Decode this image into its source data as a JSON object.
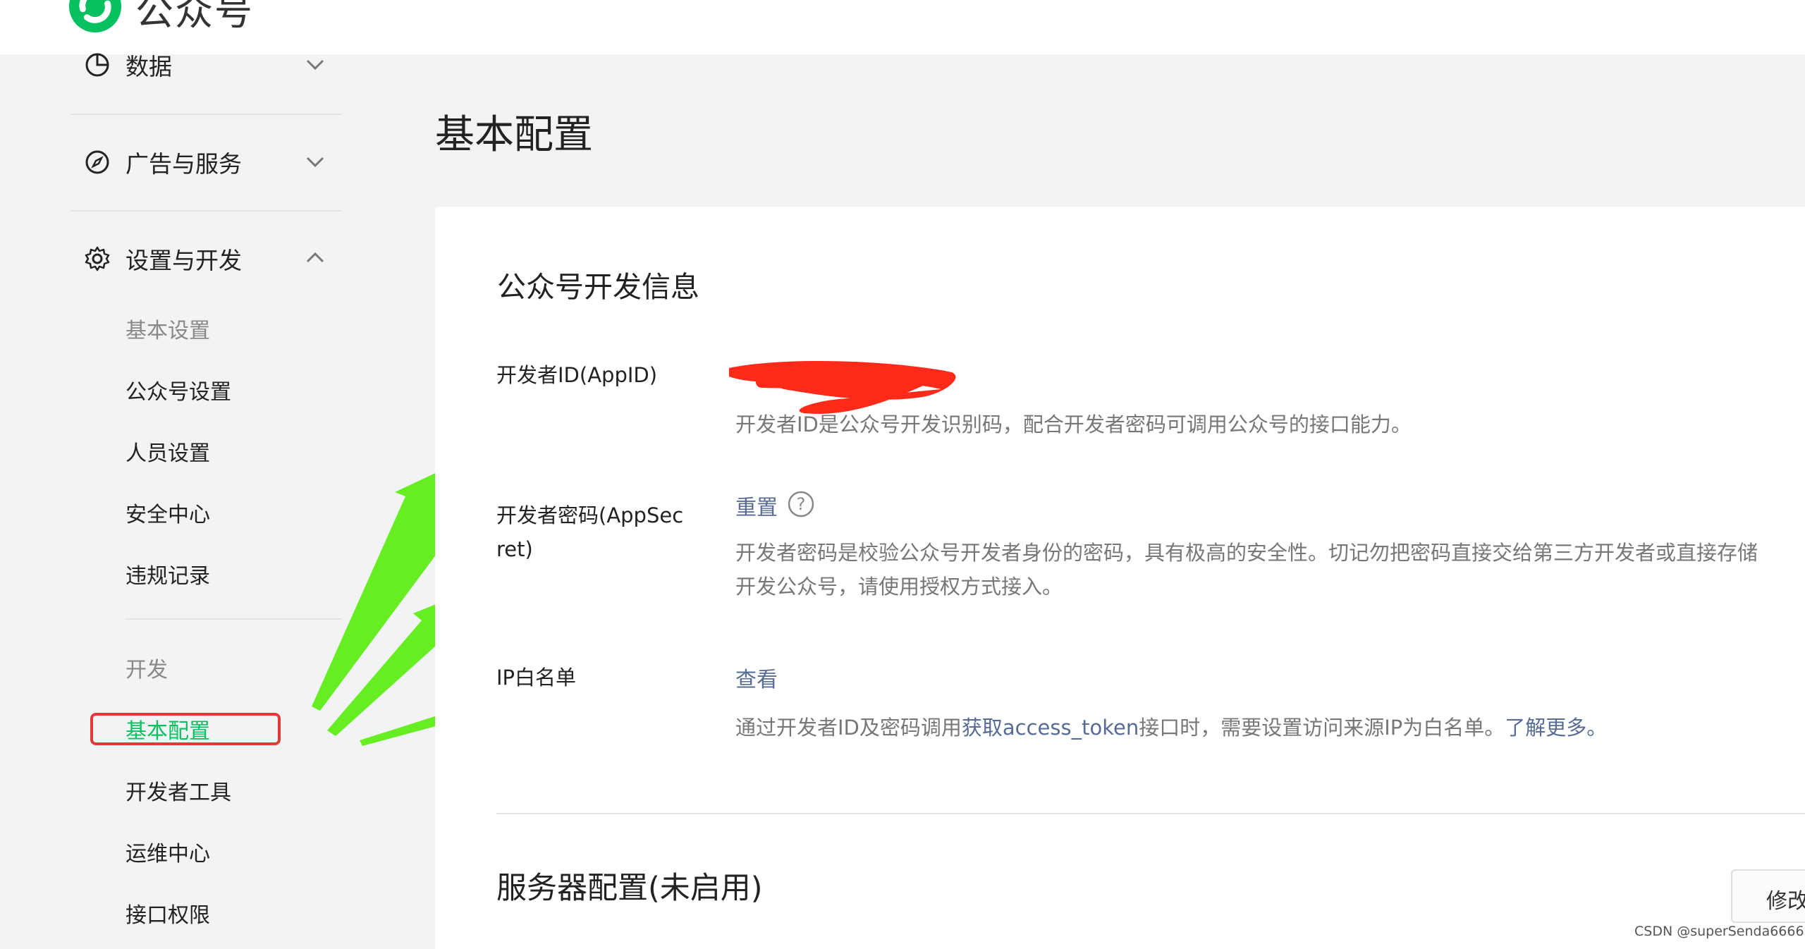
{
  "header": {
    "brand": "公众号"
  },
  "sidebar": {
    "sections": [
      {
        "label": "数据",
        "icon": "pie-chart-icon",
        "expanded": false
      },
      {
        "label": "广告与服务",
        "icon": "compass-icon",
        "expanded": false
      },
      {
        "label": "设置与开发",
        "icon": "gear-icon",
        "expanded": true
      }
    ],
    "settings_group_label": "基本设置",
    "settings_items": [
      "公众号设置",
      "人员设置",
      "安全中心",
      "违规记录"
    ],
    "dev_group_label": "开发",
    "dev_items": [
      "基本配置",
      "开发者工具",
      "运维中心",
      "接口权限"
    ],
    "active_item": "基本配置"
  },
  "main": {
    "page_title": "基本配置",
    "card_title": "公众号开发信息",
    "appid": {
      "label": "开发者ID(AppID)",
      "desc": "开发者ID是公众号开发识别码，配合开发者密码可调用公众号的接口能力。"
    },
    "secret": {
      "label": "开发者密码(AppSecret)",
      "label_line1": "开发者密码(AppSec",
      "label_line2": "ret)",
      "action": "重置",
      "help_symbol": "?",
      "desc_line1": "开发者密码是校验公众号开发者身份的密码，具有极高的安全性。切记勿把密码直接交给第三方开发者或直接存储",
      "desc_line2": "开发公众号，请使用授权方式接入。"
    },
    "ip": {
      "label": "IP白名单",
      "action": "查看",
      "desc_prefix": "通过开发者ID及密码调用",
      "desc_link": "获取access_token",
      "desc_middle": "接口时，需要设置访问来源IP为白名单。",
      "desc_more": "了解更多。"
    },
    "server_section_title": "服务器配置(未启用)",
    "edit_button": "修改"
  },
  "colors": {
    "active_green": "#07c160",
    "link_blue": "#576b95",
    "highlight_red": "#e53935",
    "arrow_green": "#66ee22",
    "redaction_red": "#ff2a1a"
  },
  "footer": {
    "watermark": "CSDN @superSenda6666"
  }
}
